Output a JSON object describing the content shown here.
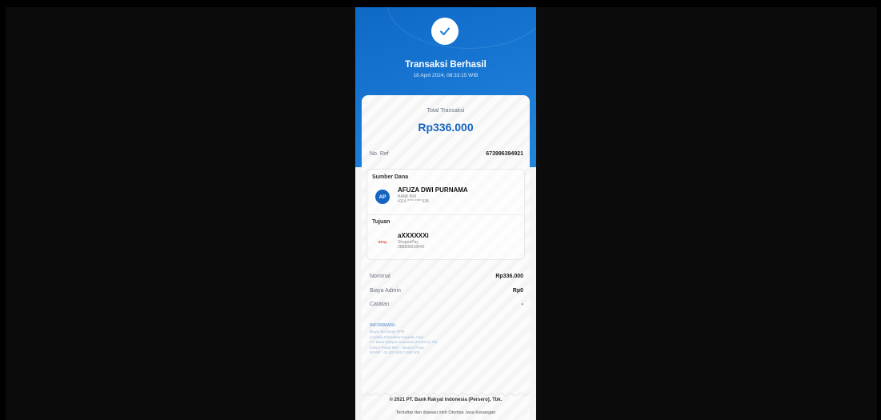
{
  "receipt": {
    "title": "Transaksi Berhasil",
    "datetime": "18 April 2024, 08:33:15 WIB",
    "total_label": "Total Transaksi",
    "total_value": "Rp336.000",
    "ref_label": "No. Ref",
    "ref_value": "673996394921"
  },
  "source": {
    "section_label": "Sumber Dana",
    "avatar_initials": "AP",
    "name": "AFUZA DWI PURNAMA",
    "bank": "BANK BRI",
    "account": "4114 **** **** 538"
  },
  "destination": {
    "section_label": "Tujuan",
    "logo_text": "SPay",
    "name": "aXXXXXXi",
    "provider": "ShopeePay",
    "account": "088808318645"
  },
  "details": [
    {
      "label": "Nominal",
      "value": "Rp336.000"
    },
    {
      "label": "Biaya Admin",
      "value": "Rp0"
    },
    {
      "label": "Catatan",
      "value": "-"
    }
  ],
  "info": {
    "title": "INFORMASI:",
    "lines": [
      "Biaya Termasuk PPN",
      "(Apabila Dikenakan/Apabila Ada)",
      "PT. Bank Rakyat Indonesia (Persero) Tbk.",
      "Kantor Pusat BRI - Jakarta Pusat",
      "NPWP : 01.001.608.7-093.000"
    ]
  },
  "footer": {
    "copyright": "© 2021 PT. Bank Rakyat Indonesia (Persero), Tbk.",
    "regulator": "Terdaftar dan diawasi oleh Otoritas Jasa Keuangan"
  },
  "colors": {
    "header_blue": "#1a7ad6",
    "amount_blue": "#1565c0"
  }
}
